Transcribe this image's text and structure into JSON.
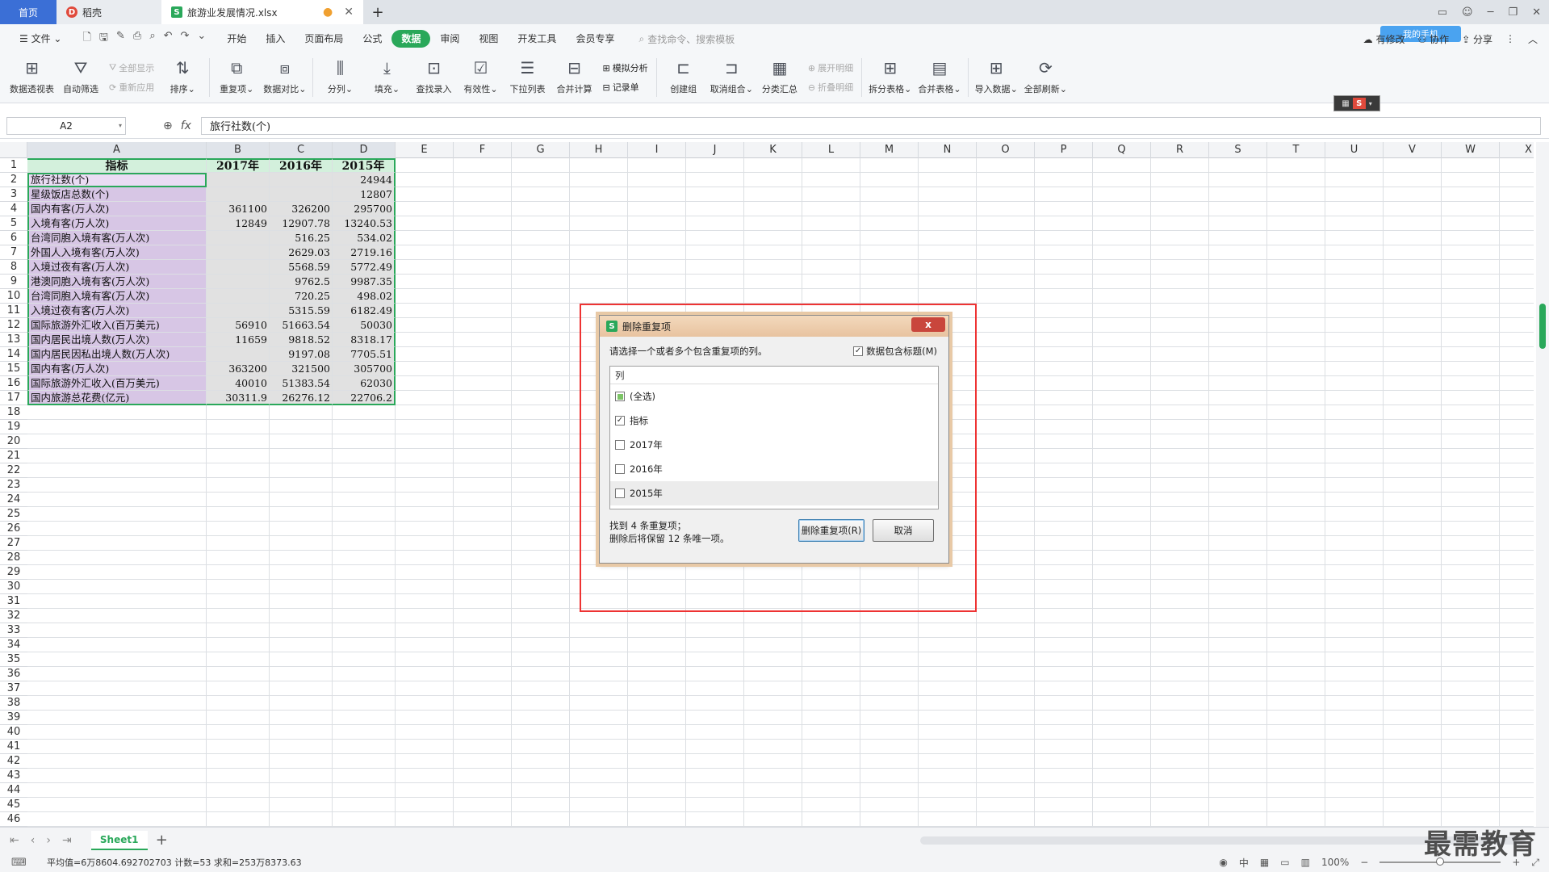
{
  "tabs": {
    "home": "首页",
    "daoke": "稻壳",
    "doc": "旅游业发展情况.xlsx"
  },
  "menu": {
    "file": "文件",
    "items": [
      "开始",
      "插入",
      "页面布局",
      "公式",
      "数据",
      "审阅",
      "视图",
      "开发工具",
      "会员专享"
    ],
    "active_index": 4,
    "search_placeholder": "查找命令、搜索模板",
    "sync": "有修改",
    "collab": "协作",
    "share": "分享",
    "cloud_badge": "我的手机"
  },
  "ribbon": {
    "pivot": "数据透视表",
    "autofilter": "自动筛选",
    "show_all": "全部显示",
    "reapply": "重新应用",
    "sort": "排序",
    "duplicates": "重复项",
    "compare": "数据对比",
    "split_col": "分列",
    "fill": "填充",
    "lookup": "查找录入",
    "validity": "有效性",
    "dropdown": "下拉列表",
    "consolidate": "合并计算",
    "simulate": "模拟分析",
    "record": "记录单",
    "group": "创建组",
    "ungroup": "取消组合",
    "subtotal": "分类汇总",
    "expand": "展开明细",
    "collapse": "折叠明细",
    "split_table": "拆分表格",
    "merge_table": "合并表格",
    "import": "导入数据",
    "refresh_all": "全部刷新"
  },
  "formula_bar": {
    "cell_ref": "A2",
    "fx": "fx",
    "content": "旅行社数(个)"
  },
  "columns": [
    "A",
    "B",
    "C",
    "D",
    "E",
    "F",
    "G",
    "H",
    "I",
    "J",
    "K",
    "L",
    "M",
    "N",
    "O",
    "P",
    "Q",
    "R",
    "S",
    "T",
    "U",
    "V",
    "W",
    "X"
  ],
  "rows": [
    "1",
    "2",
    "3",
    "4",
    "5",
    "6",
    "7",
    "8",
    "9",
    "10",
    "11",
    "12",
    "13",
    "14",
    "15",
    "16",
    "17",
    "18",
    "19",
    "20",
    "21",
    "22",
    "23",
    "24",
    "25",
    "26",
    "27",
    "28",
    "29",
    "30",
    "31",
    "32",
    "33",
    "34",
    "35",
    "36",
    "37",
    "38",
    "39",
    "40",
    "41",
    "42",
    "43",
    "44",
    "45",
    "46"
  ],
  "table": {
    "headers": [
      "指标",
      "2017年",
      "2016年",
      "2015年"
    ],
    "rows": [
      [
        "旅行社数(个)",
        "",
        "",
        "24944"
      ],
      [
        "星级饭店总数(个)",
        "",
        "",
        "12807"
      ],
      [
        "国内有客(万人次)",
        "361100",
        "326200",
        "295700"
      ],
      [
        "入境有客(万人次)",
        "12849",
        "12907.78",
        "13240.53"
      ],
      [
        "台湾同胞入境有客(万人次)",
        "",
        "516.25",
        "534.02"
      ],
      [
        "外国人入境有客(万人次)",
        "",
        "2629.03",
        "2719.16"
      ],
      [
        "入境过夜有客(万人次)",
        "",
        "5568.59",
        "5772.49"
      ],
      [
        "港澳同胞入境有客(万人次)",
        "",
        "9762.5",
        "9987.35"
      ],
      [
        "台湾同胞入境有客(万人次)",
        "",
        "720.25",
        "498.02"
      ],
      [
        "入境过夜有客(万人次)",
        "",
        "5315.59",
        "6182.49"
      ],
      [
        "国际旅游外汇收入(百万美元)",
        "56910",
        "51663.54",
        "50030"
      ],
      [
        "国内居民出境人数(万人次)",
        "11659",
        "9818.52",
        "8318.17"
      ],
      [
        "国内居民因私出境人数(万人次)",
        "",
        "9197.08",
        "7705.51"
      ],
      [
        "国内有客(万人次)",
        "363200",
        "321500",
        "305700"
      ],
      [
        "国际旅游外汇收入(百万美元)",
        "40010",
        "51383.54",
        "62030"
      ],
      [
        "国内旅游总花费(亿元)",
        "30311.9",
        "26276.12",
        "22706.2"
      ]
    ]
  },
  "dialog": {
    "title": "删除重复项",
    "close": "x",
    "instruction": "请选择一个或者多个包含重复项的列。",
    "has_header_label": "数据包含标题(M)",
    "has_header_checked": true,
    "list_header": "列",
    "options": [
      {
        "label": "(全选)",
        "state": "partial"
      },
      {
        "label": "指标",
        "state": "checked"
      },
      {
        "label": "2017年",
        "state": "unchecked"
      },
      {
        "label": "2016年",
        "state": "unchecked"
      },
      {
        "label": "2015年",
        "state": "unchecked"
      }
    ],
    "result_line1": "找到 4 条重复项；",
    "result_line2": "删除后将保留 12 条唯一项。",
    "delete_button": "删除重复项(R)",
    "cancel_button": "取消"
  },
  "sheet_tab": "Sheet1",
  "status": {
    "summary": "平均值=6万8604.692702703  计数=53  求和=253万8373.63",
    "zoom": "100%"
  },
  "watermark": "最需教育",
  "colors": {
    "accent": "#2aa85a",
    "home_tab": "#3b6fd6",
    "indicator_fill": "#d7c6e5",
    "value_fill": "#e1e1e1",
    "header_fill": "#d3f0dc",
    "highlight_box": "#ee3333"
  }
}
